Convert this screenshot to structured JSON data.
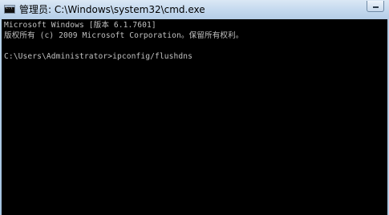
{
  "window": {
    "title": "管理员: C:\\Windows\\system32\\cmd.exe",
    "icon": "cmd-icon",
    "icon_prompt": "C:\\"
  },
  "console": {
    "lines": [
      "Microsoft Windows [版本 6.1.7601]",
      "版权所有 (c) 2009 Microsoft Corporation。保留所有权利。",
      "C:\\Users\\Administrator>ipconfig/flushdns"
    ]
  },
  "colors": {
    "console_bg": "#000000",
    "console_text": "#c0c0c0",
    "titlebar": "#c3d8ee"
  }
}
